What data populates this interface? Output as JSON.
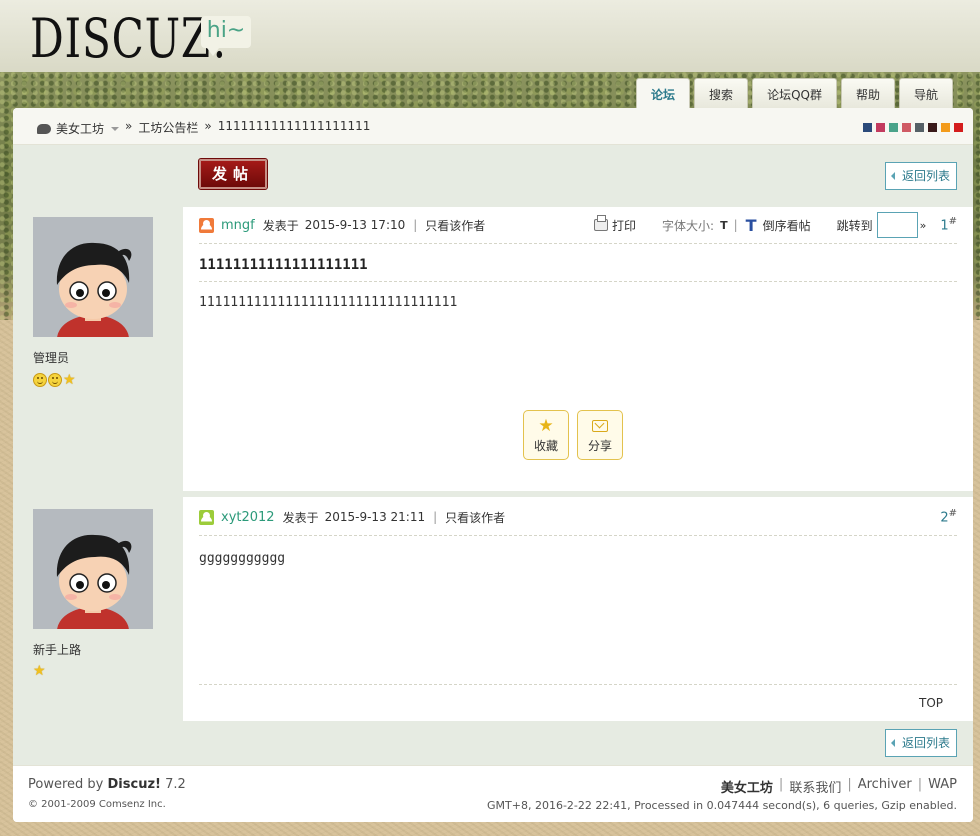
{
  "header": {
    "logo_text": "DISCUZ!",
    "greeting": "hi~"
  },
  "nav": {
    "tabs": [
      {
        "label": "论坛",
        "active": true
      },
      {
        "label": "搜索",
        "active": false
      },
      {
        "label": "论坛QQ群",
        "active": false
      },
      {
        "label": "帮助",
        "active": false
      },
      {
        "label": "导航",
        "active": false
      }
    ]
  },
  "breadcrumb": {
    "home": "美女工坊",
    "sep": "»",
    "forum": "工坊公告栏",
    "thread": "11111111111111111111"
  },
  "theme_swatches": [
    "#2b4a7a",
    "#c33b5f",
    "#4aa38a",
    "#cf5a64",
    "#556066",
    "#3a1a1a",
    "#f39b1b",
    "#d41d1d"
  ],
  "toolbar": {
    "post_button": "发帖",
    "return_button": "返回列表"
  },
  "posts": [
    {
      "role": "管理员",
      "badges": [
        "smile",
        "smile",
        "star"
      ],
      "author": "mngf",
      "online_color": "#f07a3a",
      "posted_prefix": "发表于",
      "posted_time": "2015-9-13 17:10",
      "only_author": "只看该作者",
      "print": "打印",
      "fontsize_label": "字体大小:",
      "fontsize_small": "T",
      "fontsize_big": "T",
      "reverse": "倒序看帖",
      "jump_label": "跳转到",
      "jump_go": "»",
      "floor": "1",
      "floor_sup": "#",
      "subject": "11111111111111111111",
      "body": "111111111111111111111111111111111",
      "favorite": "收藏",
      "share": "分享"
    },
    {
      "role": "新手上路",
      "badges": [
        "star"
      ],
      "author": "xyt2012",
      "online_color": "#9ccc3a",
      "posted_prefix": "发表于",
      "posted_time": "2015-9-13 21:11",
      "only_author": "只看该作者",
      "floor": "2",
      "floor_sup": "#",
      "body": "ggggggggggg",
      "top": "TOP"
    }
  ],
  "footer": {
    "powered_prefix": "Powered by",
    "powered_brand": "Discuz!",
    "powered_version": "7.2",
    "copyright": "© 2001-2009 Comsenz Inc.",
    "links": [
      "美女工坊",
      "联系我们",
      "Archiver",
      "WAP"
    ],
    "pipe": "|",
    "stats": "GMT+8, 2016-2-22 22:41, Processed in 0.047444 second(s), 6 queries, Gzip enabled."
  }
}
